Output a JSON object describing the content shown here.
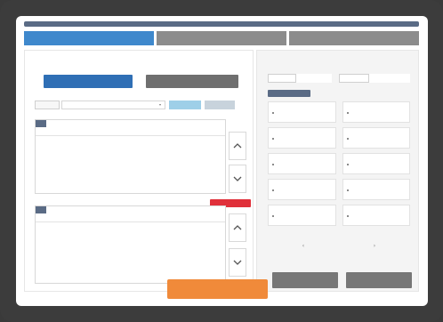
{
  "title": "",
  "tabs": [
    {
      "label": "",
      "active": true
    },
    {
      "label": "",
      "active": false
    },
    {
      "label": "",
      "active": false
    }
  ],
  "left": {
    "primary_button": "",
    "secondary_button": "",
    "filter_label": "",
    "filter_value": "",
    "filter_btn_1": "",
    "filter_btn_2": "",
    "grid1": {
      "title": "",
      "columns": [
        "",
        "",
        "",
        "",
        ""
      ],
      "row": [
        "",
        "",
        "",
        "",
        ""
      ]
    },
    "red_button": "",
    "grid2": {
      "title": "",
      "columns": [
        "",
        "",
        "",
        "",
        ""
      ]
    }
  },
  "right": {
    "field1_label": "",
    "field1_value": "",
    "field2_label": "",
    "field2_value": "",
    "section_title": "",
    "tiles": [
      "",
      "",
      "",
      "",
      "",
      "",
      "",
      "",
      "",
      ""
    ],
    "pager_prev": "‹",
    "pager_next": "›",
    "bottom_btn_1": "",
    "bottom_btn_2": ""
  },
  "submit_label": "",
  "colors": {
    "accent_blue": "#3f88cc",
    "dark_blue": "#2f6fb5",
    "header_slate": "#5a6b85",
    "submit_orange": "#f08a3a",
    "danger_red": "#e0303a"
  }
}
